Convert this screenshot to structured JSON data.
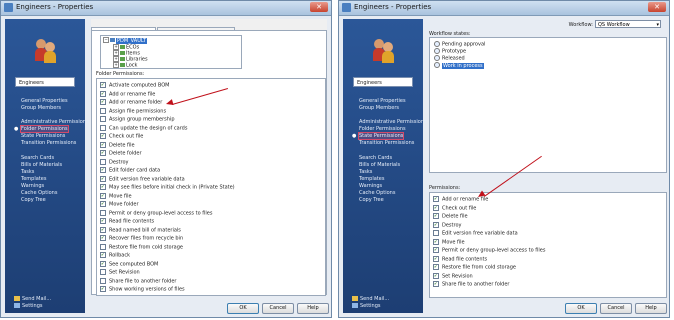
{
  "left_window": {
    "title": "Engineers - Properties",
    "close_label": "✕",
    "group_name": "Engineers",
    "nav": {
      "general": "General Properties",
      "members": "Group Members",
      "admin": "Administrative Permissions",
      "folder": "Folder Permissions",
      "state": "State Permissions",
      "transition": "Transition Permissions",
      "search": "Search Cards",
      "bom": "Bills of Materials",
      "tasks": "Tasks",
      "templates": "Templates",
      "warnings": "Warnings",
      "cache": "Cache Options",
      "copytree": "Copy Tree",
      "sendmail": "Send Mail...",
      "settings": "Settings"
    },
    "tabs": [
      "Permissions per Folder",
      "Assigned Folder Permissions"
    ],
    "tree": {
      "root": "PDM_VAULT",
      "children": [
        "ECOs",
        "Items",
        "Libraries",
        "Lock"
      ]
    },
    "permissions_label": "Folder Permissions:",
    "permissions": [
      {
        "label": "Activate computed BOM",
        "checked": true
      },
      {
        "label": "Add or rename file",
        "checked": true
      },
      {
        "label": "Add or rename folder",
        "checked": true
      },
      {
        "label": "Assign file permissions",
        "checked": false
      },
      {
        "label": "Assign group membership",
        "checked": false
      },
      {
        "label": "Can update the design of cards",
        "checked": false
      },
      {
        "label": "Check out file",
        "checked": true
      },
      {
        "label": "Delete file",
        "checked": true
      },
      {
        "label": "Delete folder",
        "checked": true
      },
      {
        "label": "Destroy",
        "checked": false
      },
      {
        "label": "Edit folder card data",
        "checked": true
      },
      {
        "label": "Edit version free variable data",
        "checked": true
      },
      {
        "label": "May see files before initial check in (Private State)",
        "checked": true
      },
      {
        "label": "Move file",
        "checked": true
      },
      {
        "label": "Move folder",
        "checked": true
      },
      {
        "label": "Permit or deny group-level access to files",
        "checked": false
      },
      {
        "label": "Read file contents",
        "checked": true
      },
      {
        "label": "Read named bill of materials",
        "checked": true
      },
      {
        "label": "Recover files from recycle bin",
        "checked": true
      },
      {
        "label": "Restore file from cold storage",
        "checked": false
      },
      {
        "label": "Rollback",
        "checked": true
      },
      {
        "label": "See computed BOM",
        "checked": true
      },
      {
        "label": "Set Revision",
        "checked": false
      },
      {
        "label": "Share file to another folder",
        "checked": false
      },
      {
        "label": "Show working versions of files",
        "checked": true
      }
    ],
    "buttons": {
      "ok": "OK",
      "cancel": "Cancel",
      "help": "Help"
    }
  },
  "right_window": {
    "title": "Engineers - Properties",
    "close_label": "✕",
    "group_name": "Engineers",
    "workflow_label": "Workflow:",
    "workflow_value": "QS Workflow",
    "workflow_states_label": "Workflow states:",
    "states": [
      "Pending approval",
      "Prototype",
      "Released",
      "Work in process"
    ],
    "permissions_label": "Permissions:",
    "permissions": [
      {
        "label": "Add or rename file",
        "checked": true
      },
      {
        "label": "Check out file",
        "checked": true
      },
      {
        "label": "Delete file",
        "checked": true
      },
      {
        "label": "Destroy",
        "checked": true
      },
      {
        "label": "Edit version free variable data",
        "checked": false
      },
      {
        "label": "Move file",
        "checked": true
      },
      {
        "label": "Permit or deny group-level access to files",
        "checked": true
      },
      {
        "label": "Read file contents",
        "checked": true
      },
      {
        "label": "Restore file from cold storage",
        "checked": true
      },
      {
        "label": "Set Revision",
        "checked": true
      },
      {
        "label": "Share file to another folder",
        "checked": true
      }
    ],
    "buttons": {
      "ok": "OK",
      "cancel": "Cancel",
      "help": "Help"
    }
  },
  "colors": {
    "sidebar": "#2b5798",
    "highlight": "#d24a6a",
    "arrow": "#c0101a"
  }
}
